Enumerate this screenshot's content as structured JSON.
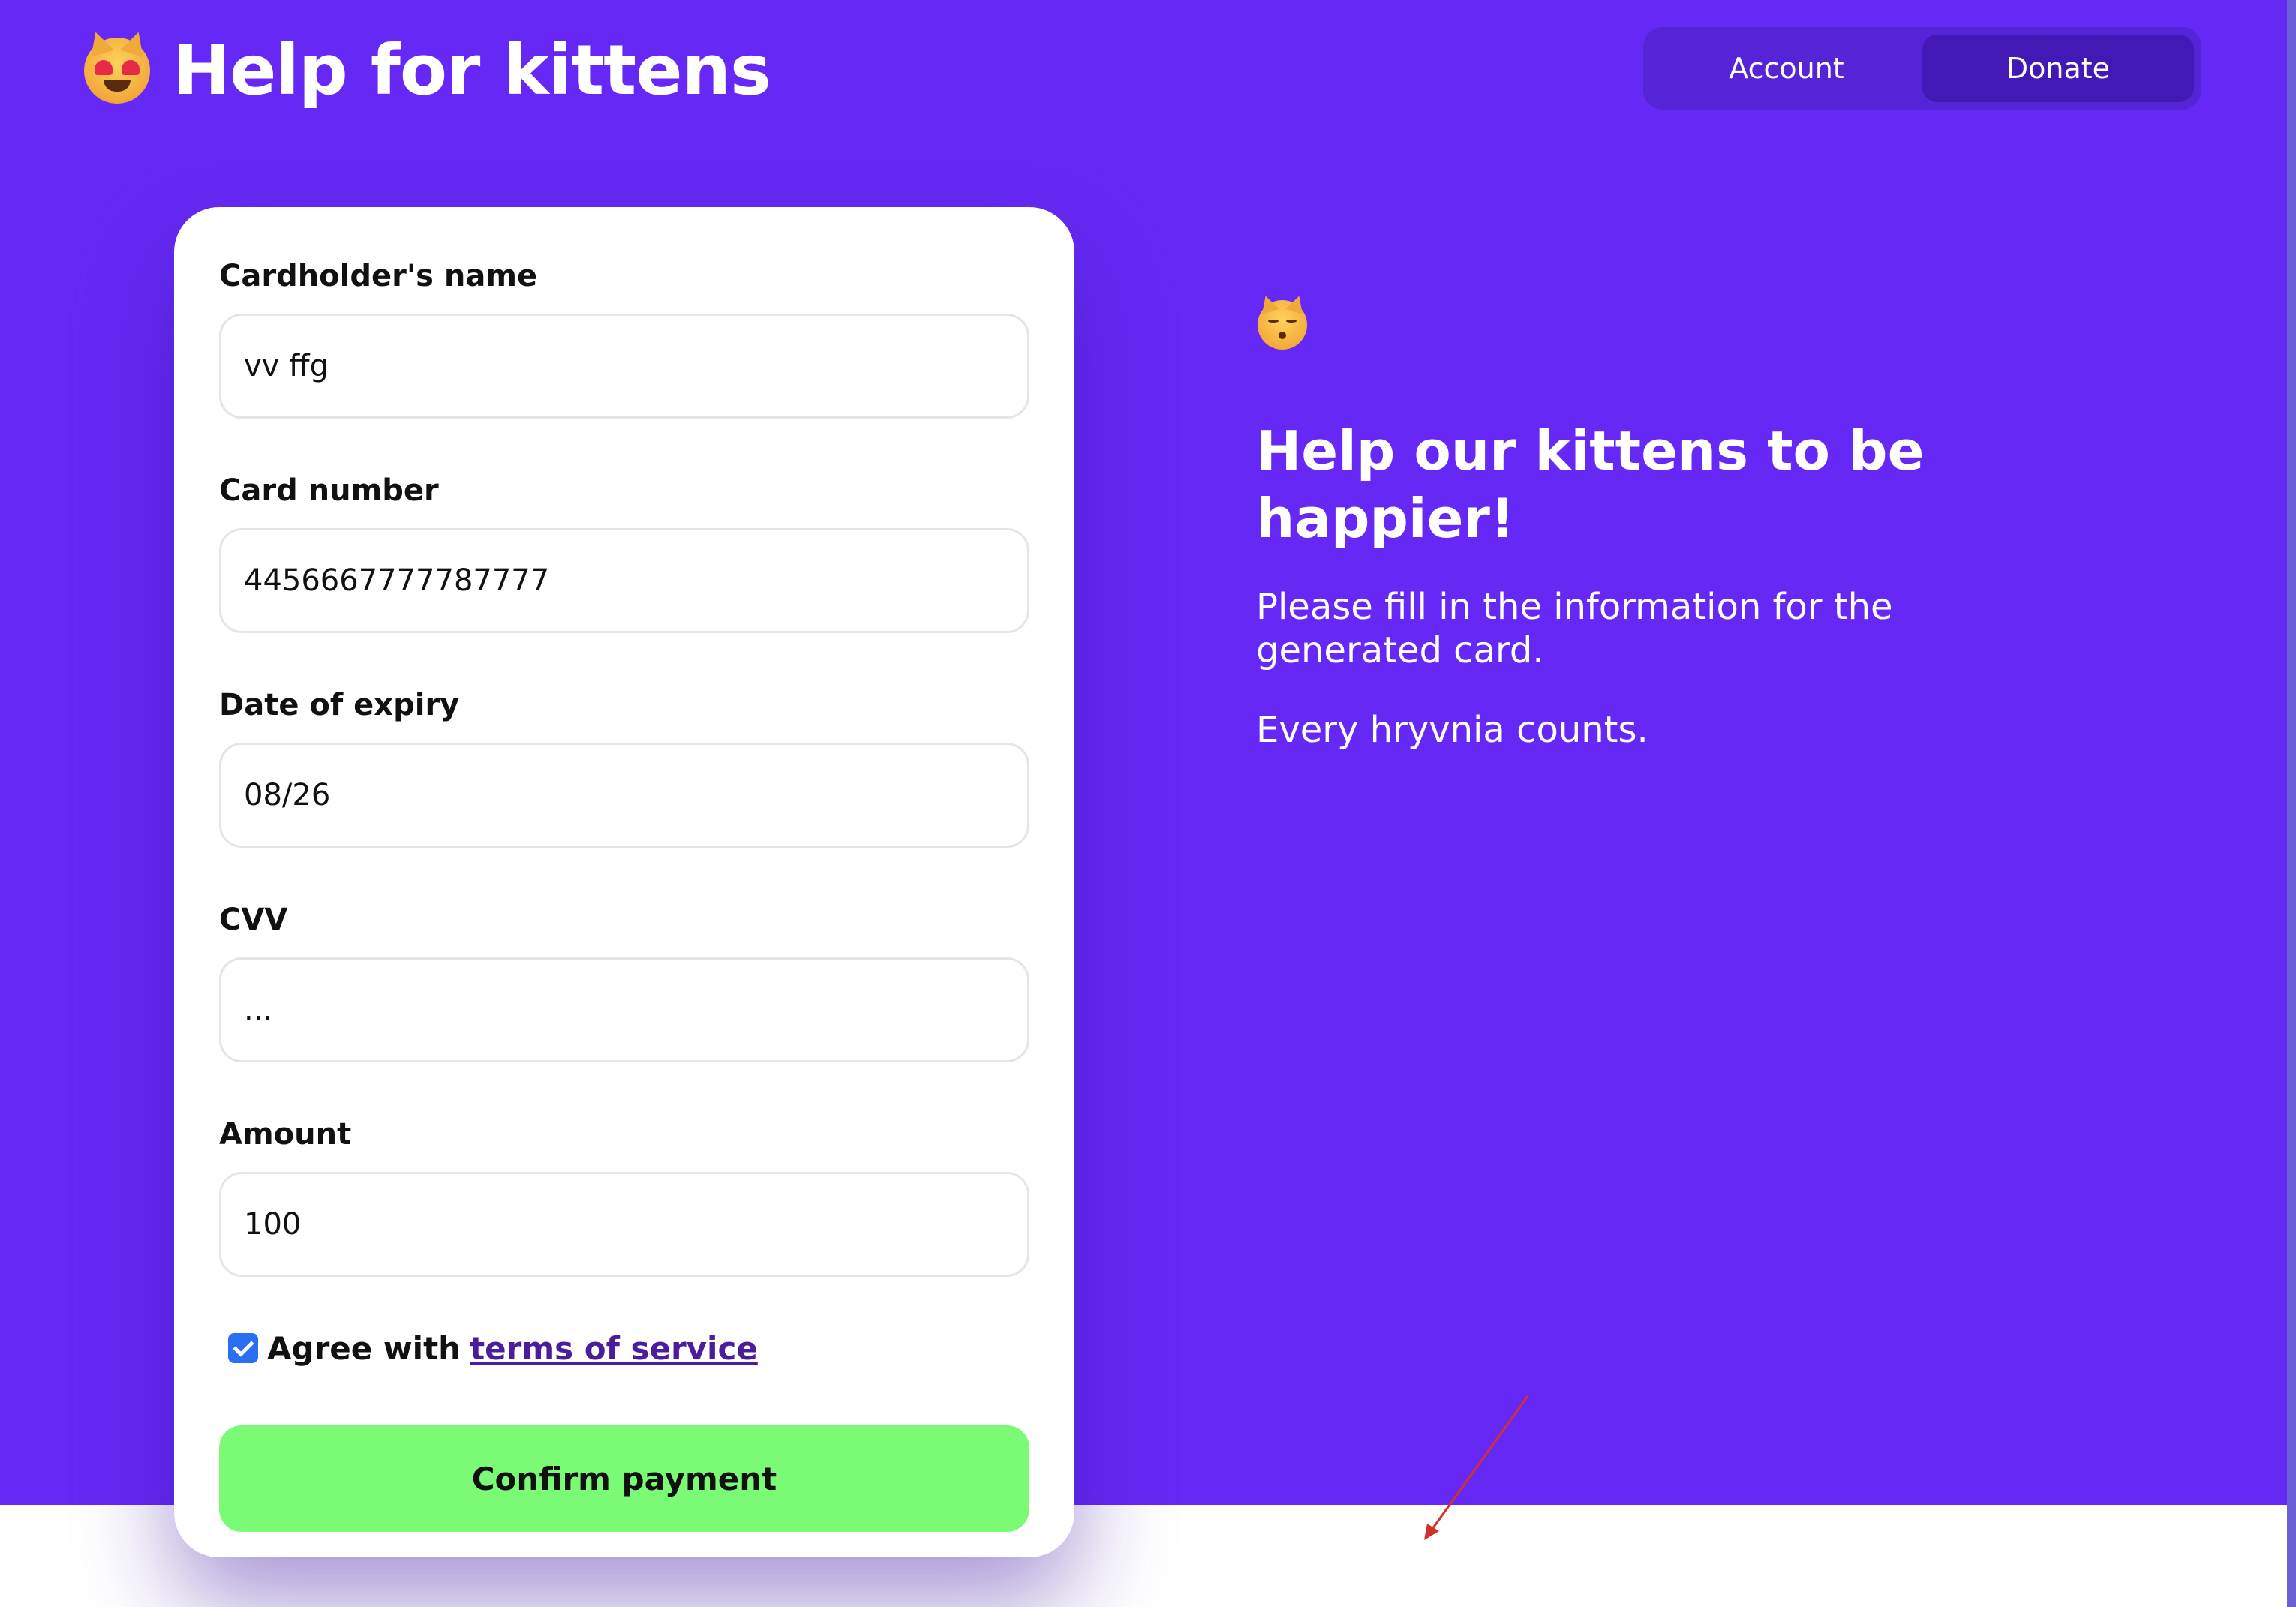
{
  "app": {
    "title": "Help for kittens",
    "brand_icon": "heart-eyes-cat-emoji"
  },
  "nav": {
    "items": [
      {
        "label": "Account",
        "active": false
      },
      {
        "label": "Donate",
        "active": true
      }
    ]
  },
  "form": {
    "fields": [
      {
        "label": "Cardholder's name",
        "value": "vv ffg"
      },
      {
        "label": "Card number",
        "value": "4456667777787777"
      },
      {
        "label": "Date of expiry",
        "value": "08/26"
      },
      {
        "label": "CVV",
        "value": "..."
      },
      {
        "label": "Amount",
        "value": "100"
      }
    ],
    "agree": {
      "checked": true,
      "text": "Agree with",
      "link_text": "terms of service"
    },
    "submit_label": "Confirm payment"
  },
  "promo": {
    "icon": "kissing-cat-emoji",
    "heading": "Help our kittens to be happier!",
    "paragraphs": [
      "Please fill in the information for the generated card.",
      "Every hryvnia counts."
    ]
  },
  "colors": {
    "primary": "#6629f5",
    "nav_bg": "#5424d6",
    "nav_active": "#4219b4",
    "confirm_button": "#7bfa76",
    "link": "#4a1d9c",
    "checkbox": "#2a6ef2",
    "annotation_arrow": "#d0312d"
  }
}
